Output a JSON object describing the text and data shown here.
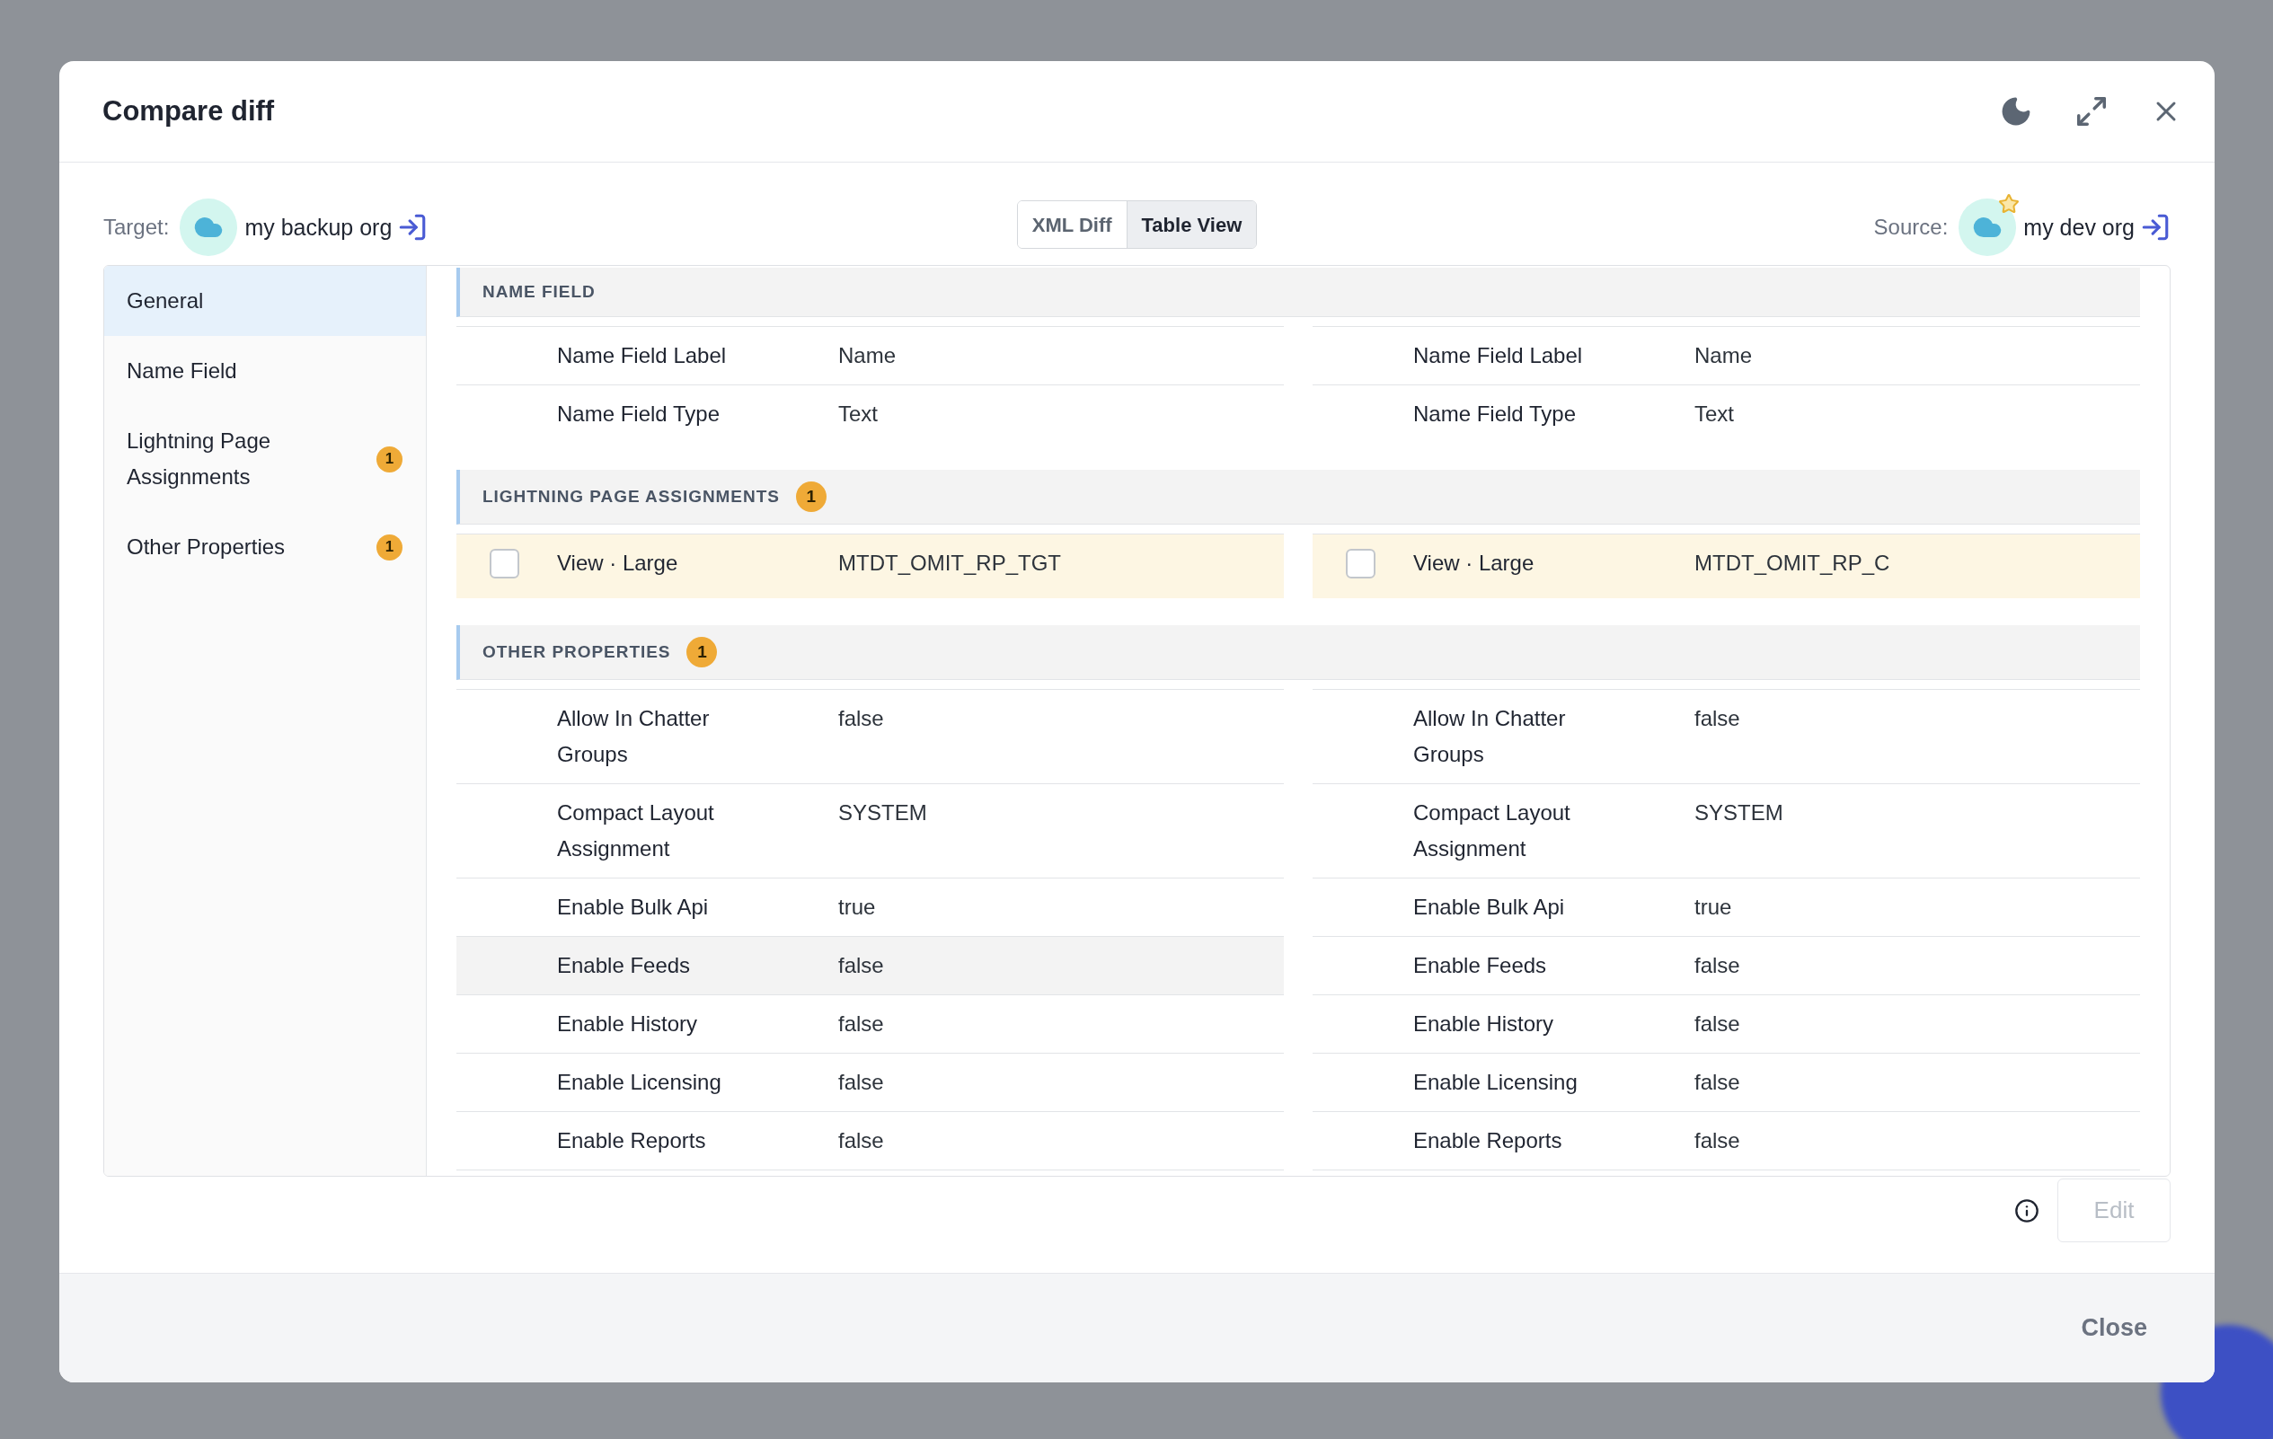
{
  "dialog": {
    "title": "Compare diff"
  },
  "target": {
    "label": "Target:",
    "org": "my backup org",
    "starred": false
  },
  "view_tabs": [
    {
      "label": "XML Diff",
      "selected": false
    },
    {
      "label": "Table View",
      "selected": true
    }
  ],
  "source": {
    "label": "Source:",
    "org": "my dev org",
    "starred": true
  },
  "sidebar": {
    "items": [
      {
        "label": "General",
        "selected": true
      },
      {
        "label": "Name Field",
        "selected": false
      },
      {
        "label": "Lightning Page Assignments",
        "selected": false,
        "badge": "1"
      },
      {
        "label": "Other Properties",
        "selected": false,
        "badge": "1"
      }
    ]
  },
  "sections": [
    {
      "title": "NAME FIELD",
      "rows": [
        {
          "kind": "field",
          "changed": false,
          "left": {
            "label": "Name Field Label",
            "value": "Name",
            "hovered": false
          },
          "right": {
            "label": "Name Field Label",
            "value": "Name",
            "hovered": false
          }
        },
        {
          "kind": "field",
          "changed": false,
          "left": {
            "label": "Name Field Type",
            "value": "Text",
            "hovered": false
          },
          "right": {
            "label": "Name Field Type",
            "value": "Text",
            "hovered": false
          }
        }
      ]
    },
    {
      "title": "LIGHTNING PAGE ASSIGNMENTS",
      "badge": "1",
      "rows": [
        {
          "kind": "selectable",
          "changed": true,
          "left": {
            "label": "View · Large",
            "value": "MTDT_OMIT_RP_TGT",
            "checked": false,
            "hovered": false
          },
          "right": {
            "label": "View · Large",
            "value": "MTDT_OMIT_RP_C",
            "checked": false,
            "hovered": false
          }
        }
      ]
    },
    {
      "title": "OTHER PROPERTIES",
      "badge": "1",
      "rows": [
        {
          "kind": "field",
          "changed": false,
          "left": {
            "label": "Allow In Chatter Groups",
            "value": "false",
            "hovered": false
          },
          "right": {
            "label": "Allow In Chatter Groups",
            "value": "false",
            "hovered": false
          }
        },
        {
          "kind": "field",
          "changed": false,
          "left": {
            "label": "Compact Layout Assignment",
            "value": "SYSTEM",
            "hovered": false
          },
          "right": {
            "label": "Compact Layout Assignment",
            "value": "SYSTEM",
            "hovered": false
          }
        },
        {
          "kind": "field",
          "changed": false,
          "left": {
            "label": "Enable Bulk Api",
            "value": "true",
            "hovered": false
          },
          "right": {
            "label": "Enable Bulk Api",
            "value": "true",
            "hovered": false
          }
        },
        {
          "kind": "field",
          "changed": false,
          "left": {
            "label": "Enable Feeds",
            "value": "false",
            "hovered": true
          },
          "right": {
            "label": "Enable Feeds",
            "value": "false",
            "hovered": false
          }
        },
        {
          "kind": "field",
          "changed": false,
          "left": {
            "label": "Enable History",
            "value": "false",
            "hovered": false
          },
          "right": {
            "label": "Enable History",
            "value": "false",
            "hovered": false
          }
        },
        {
          "kind": "field",
          "changed": false,
          "left": {
            "label": "Enable Licensing",
            "value": "false",
            "hovered": false
          },
          "right": {
            "label": "Enable Licensing",
            "value": "false",
            "hovered": false
          }
        },
        {
          "kind": "field",
          "changed": false,
          "left": {
            "label": "Enable Reports",
            "value": "false",
            "hovered": false
          },
          "right": {
            "label": "Enable Reports",
            "value": "false",
            "hovered": false
          }
        }
      ]
    }
  ],
  "edit_button": {
    "label": "Edit",
    "disabled": true
  },
  "footer": {
    "close_button": "Close"
  }
}
